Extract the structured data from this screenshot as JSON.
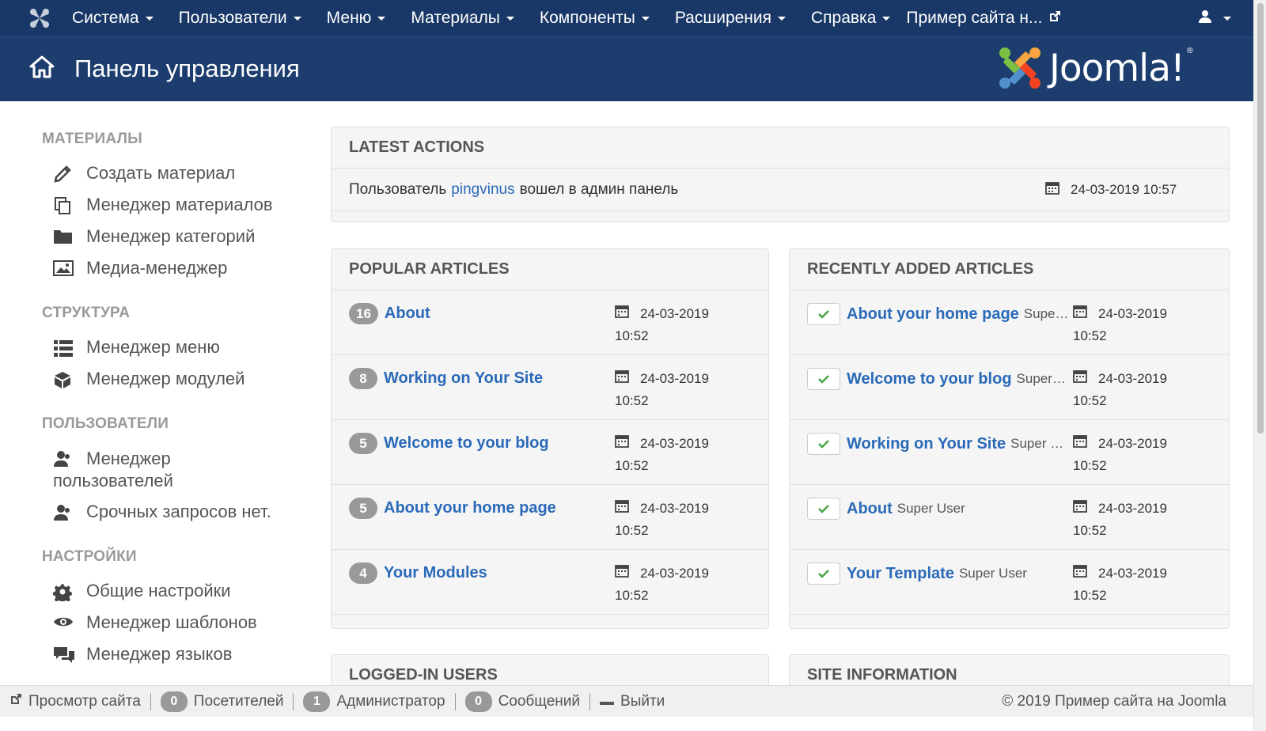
{
  "topbar": {
    "menu": [
      {
        "label": "Система"
      },
      {
        "label": "Пользователи"
      },
      {
        "label": "Меню"
      },
      {
        "label": "Материалы"
      },
      {
        "label": "Компоненты"
      },
      {
        "label": "Расширения"
      },
      {
        "label": "Справка"
      }
    ],
    "site_link": "Пример сайта н...",
    "user_icon": "user-icon"
  },
  "header": {
    "title": "Панель управления",
    "logo_text": "Joomla!",
    "logo_mark": "®"
  },
  "sidebar": {
    "sections": [
      {
        "heading": "МАТЕРИАЛЫ",
        "items": [
          {
            "label": "Создать материал",
            "icon": "pencil-icon"
          },
          {
            "label": "Менеджер материалов",
            "icon": "copy-icon"
          },
          {
            "label": "Менеджер категорий",
            "icon": "folder-icon"
          },
          {
            "label": "Медиа-менеджер",
            "icon": "image-icon"
          }
        ]
      },
      {
        "heading": "СТРУКТУРА",
        "items": [
          {
            "label": "Менеджер меню",
            "icon": "list-icon"
          },
          {
            "label": "Менеджер модулей",
            "icon": "cube-icon"
          }
        ]
      },
      {
        "heading": "ПОЛЬЗОВАТЕЛИ",
        "items": [
          {
            "label": "Менеджер",
            "label2": "пользователей",
            "icon": "users-icon"
          },
          {
            "label": "Срочных запросов нет.",
            "icon": "users-icon"
          }
        ]
      },
      {
        "heading": "НАСТРОЙКИ",
        "items": [
          {
            "label": "Общие настройки",
            "icon": "gear-icon"
          },
          {
            "label": "Менеджер шаблонов",
            "icon": "eye-icon"
          },
          {
            "label": "Менеджер языков",
            "icon": "comments-icon"
          }
        ]
      }
    ]
  },
  "latest_actions": {
    "heading": "LATEST ACTIONS",
    "rows": [
      {
        "prefix": "Пользователь",
        "user": "pingvinus",
        "suffix": "вошел в админ панель",
        "date": "24-03-2019 10:57"
      }
    ]
  },
  "popular_articles": {
    "heading": "POPULAR ARTICLES",
    "rows": [
      {
        "hits": "16",
        "title": "About",
        "date": "24-03-2019",
        "time": "10:52"
      },
      {
        "hits": "8",
        "title": "Working on Your Site",
        "date": "24-03-2019",
        "time": "10:52"
      },
      {
        "hits": "5",
        "title": "Welcome to your blog",
        "date": "24-03-2019",
        "time": "10:52"
      },
      {
        "hits": "5",
        "title": "About your home page",
        "date": "24-03-2019",
        "time": "10:52"
      },
      {
        "hits": "4",
        "title": "Your Modules",
        "date": "24-03-2019",
        "time": "10:52"
      }
    ]
  },
  "recent_articles": {
    "heading": "RECENTLY ADDED ARTICLES",
    "rows": [
      {
        "title": "About your home page",
        "author": "Supe…",
        "date": "24-03-2019",
        "time": "10:52"
      },
      {
        "title": "Welcome to your blog",
        "author": "Super…",
        "date": "24-03-2019",
        "time": "10:52"
      },
      {
        "title": "Working on Your Site",
        "author": "Super …",
        "date": "24-03-2019",
        "time": "10:52"
      },
      {
        "title": "About",
        "author": "Super User",
        "date": "24-03-2019",
        "time": "10:52"
      },
      {
        "title": "Your Template",
        "author": "Super User",
        "date": "24-03-2019",
        "time": "10:52"
      }
    ]
  },
  "logged_in_users": {
    "heading": "LOGGED-IN USERS"
  },
  "site_information": {
    "heading": "SITE INFORMATION"
  },
  "footer": {
    "view_site": "Просмотр сайта",
    "visitors_count": "0",
    "visitors_label": "Посетителей",
    "admins_count": "1",
    "admins_label": "Администратор",
    "messages_count": "0",
    "messages_label": "Сообщений",
    "logout": "Выйти",
    "copyright": "© 2019 Пример сайта на Joomla"
  },
  "colors": {
    "topbar": "#1a3867",
    "header": "#1c3d6e",
    "link": "#2a6ab8",
    "badge": "#999999",
    "check": "#46a546"
  }
}
